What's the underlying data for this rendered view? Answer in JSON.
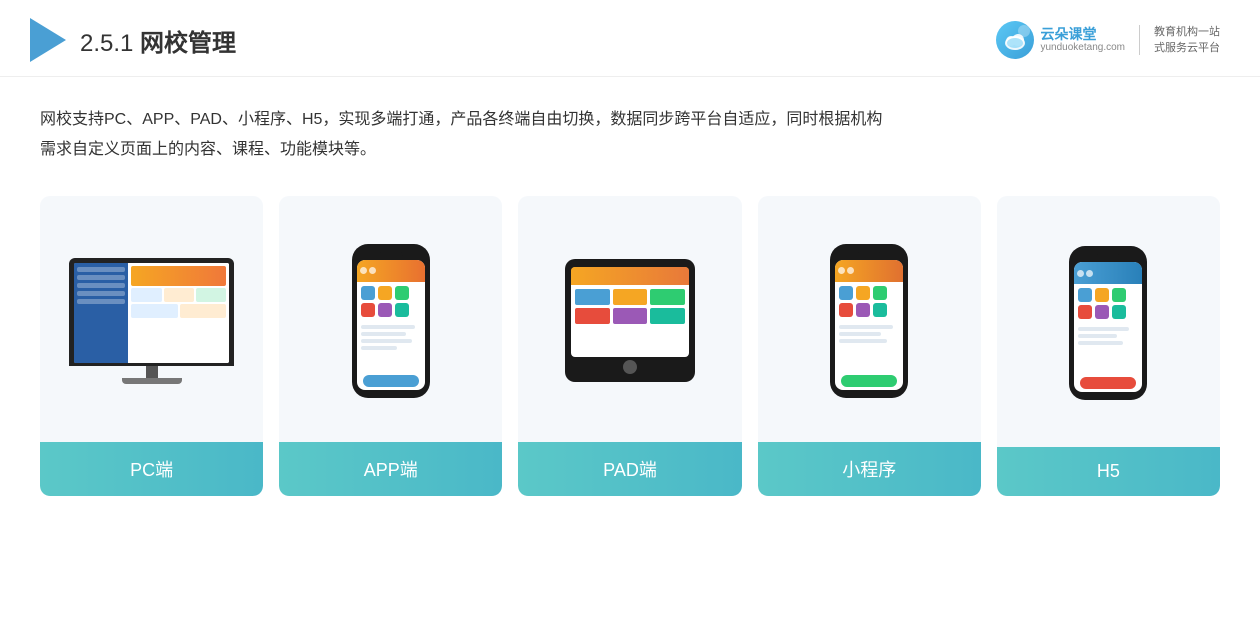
{
  "header": {
    "section_number": "2.5.1",
    "title_prefix": "2.5.1 ",
    "title_bold": "网校管理",
    "brand": {
      "name_line1": "云朵课堂",
      "url": "yunduoketang.com",
      "slogan_line1": "教育机构一站",
      "slogan_line2": "式服务云平台"
    }
  },
  "description": {
    "text_line1": "网校支持PC、APP、PAD、小程序、H5，实现多端打通，产品各终端自由切换，数据同步跨平台自适应，同时根据机构",
    "text_line2": "需求自定义页面上的内容、课程、功能模块等。"
  },
  "cards": [
    {
      "id": "pc",
      "label": "PC端"
    },
    {
      "id": "app",
      "label": "APP端"
    },
    {
      "id": "pad",
      "label": "PAD端"
    },
    {
      "id": "miniprogram",
      "label": "小程序"
    },
    {
      "id": "h5",
      "label": "H5"
    }
  ]
}
